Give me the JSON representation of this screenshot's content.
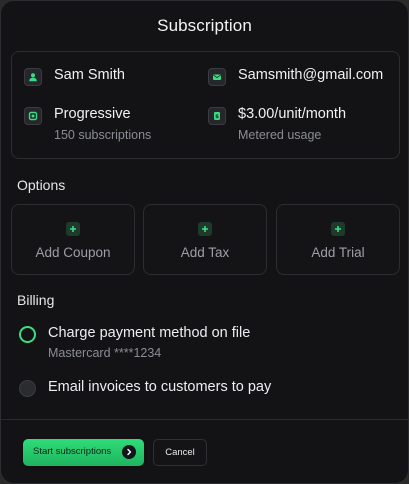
{
  "dialog": {
    "title": "Subscription"
  },
  "summary": {
    "customer_name": "Sam Smith",
    "email": "Samsmith@gmail.com",
    "plan_name": "Progressive",
    "plan_sub": "150 subscriptions",
    "price": "$3.00/unit/month",
    "price_sub": "Metered usage",
    "icons": [
      "user-icon",
      "mail-icon",
      "plan-icon",
      "dollar-icon"
    ]
  },
  "options": {
    "label": "Options",
    "items": [
      {
        "label": "Add Coupon",
        "icon": "plus-icon"
      },
      {
        "label": "Add Tax",
        "icon": "plus-icon"
      },
      {
        "label": "Add Trial",
        "icon": "plus-icon"
      }
    ]
  },
  "billing": {
    "label": "Billing",
    "choices": [
      {
        "label": "Charge payment method on file",
        "sub": "Mastercard ****1234",
        "selected": true
      },
      {
        "label": "Email invoices to customers to pay",
        "sub": "",
        "selected": false
      }
    ]
  },
  "footer": {
    "primary_label": "Start subscriptions",
    "primary_icon": "arrow-right-icon",
    "secondary_label": "Cancel"
  },
  "colors": {
    "accent": "#3ddc84",
    "background": "#131315",
    "border": "#2c2d31",
    "muted_text": "#8a8d93"
  }
}
